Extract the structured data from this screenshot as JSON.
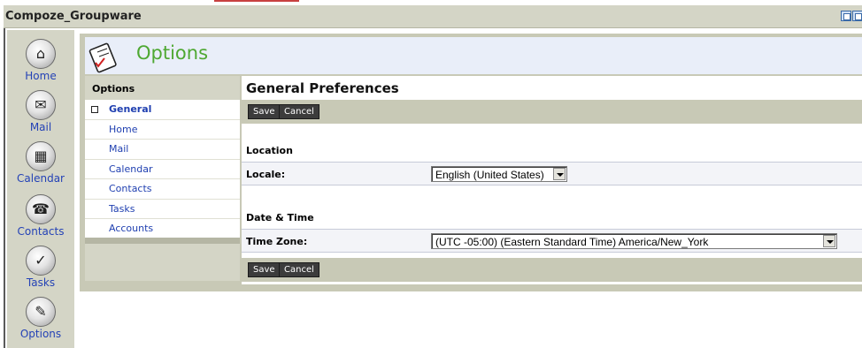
{
  "window": {
    "title": "Compoze_Groupware"
  },
  "app_nav": {
    "items": [
      {
        "label": "Home",
        "icon": "home-icon",
        "glyph": "⌂"
      },
      {
        "label": "Mail",
        "icon": "mail-icon",
        "glyph": "✉"
      },
      {
        "label": "Calendar",
        "icon": "calendar-icon",
        "glyph": "▦"
      },
      {
        "label": "Contacts",
        "icon": "contacts-icon",
        "glyph": "☎"
      },
      {
        "label": "Tasks",
        "icon": "tasks-icon",
        "glyph": "✓"
      },
      {
        "label": "Options",
        "icon": "options-icon",
        "glyph": "✎"
      }
    ]
  },
  "page": {
    "title": "Options",
    "icon": "options-clipboard-icon"
  },
  "options_sidebar": {
    "heading": "Options",
    "items": [
      {
        "label": "General",
        "active": true
      },
      {
        "label": "Home",
        "active": false
      },
      {
        "label": "Mail",
        "active": false
      },
      {
        "label": "Calendar",
        "active": false
      },
      {
        "label": "Contacts",
        "active": false
      },
      {
        "label": "Tasks",
        "active": false
      },
      {
        "label": "Accounts",
        "active": false
      }
    ]
  },
  "main": {
    "title": "General Preferences",
    "buttons": {
      "save": "Save",
      "cancel": "Cancel"
    },
    "sections": {
      "location": {
        "heading": "Location",
        "field_label": "Locale:",
        "value": "English (United States)"
      },
      "datetime": {
        "heading": "Date & Time",
        "field_label": "Time Zone:",
        "value": "(UTC -05:00) (Eastern Standard Time) America/New_York"
      }
    }
  },
  "colors": {
    "accent_green": "#4ea832",
    "link_blue": "#1f3fb0",
    "nav_label_blue": "#2442b6",
    "chrome": "#d4d5c6"
  }
}
